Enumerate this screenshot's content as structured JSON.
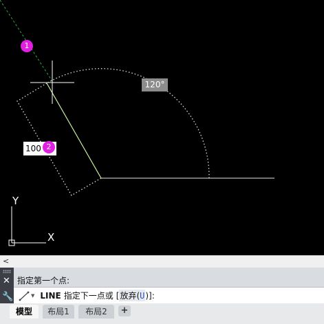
{
  "canvas": {
    "angle_label": "120°",
    "length_value": "100",
    "markers": [
      "1",
      "2"
    ],
    "ucs": {
      "x_label": "X",
      "y_label": "Y"
    }
  },
  "scroll_strip": {
    "left_arrow": "<"
  },
  "command": {
    "history_line": "指定第一个点:",
    "prefix": "LINE",
    "prompt": "指定下一点或",
    "option_open": "[",
    "option_text": "放弃(",
    "option_key": "U",
    "option_close": ")]:"
  },
  "tabs": [
    {
      "label": "模型",
      "active": true
    },
    {
      "label": "布局1",
      "active": false
    },
    {
      "label": "布局2",
      "active": false
    }
  ],
  "tab_add_label": "+",
  "colors": {
    "canvas_bg": "#000000",
    "marker": "#e01fe0",
    "rubber_band": "#c8f0a0",
    "tracking": "#2ea84a"
  },
  "icons": {
    "close": "close-icon",
    "settings": "wrench-icon",
    "command": "line-command-icon",
    "grip": "grip-icon"
  }
}
